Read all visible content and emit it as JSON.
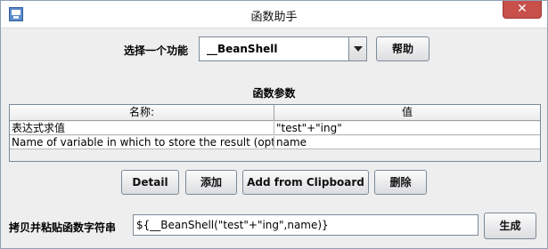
{
  "window": {
    "title": "函数助手",
    "close_label": "✕"
  },
  "function_select": {
    "label": "选择一个功能",
    "selected": "__BeanShell",
    "help_button": "帮助"
  },
  "params": {
    "title": "函数参数",
    "columns": [
      "名称:",
      "值"
    ],
    "rows": [
      {
        "name": "表达式求值",
        "value": "\"test\"+\"ing\""
      },
      {
        "name": "Name of variable in which to store the result (optional)",
        "value": "name"
      }
    ]
  },
  "actions": {
    "detail": "Detail",
    "add": "添加",
    "add_from_clipboard": "Add from Clipboard",
    "delete": "删除"
  },
  "copy": {
    "label": "拷贝并粘贴函数字符串",
    "value": "${__BeanShell(\"test\"+\"ing\",name)}",
    "generate_button": "生成"
  }
}
